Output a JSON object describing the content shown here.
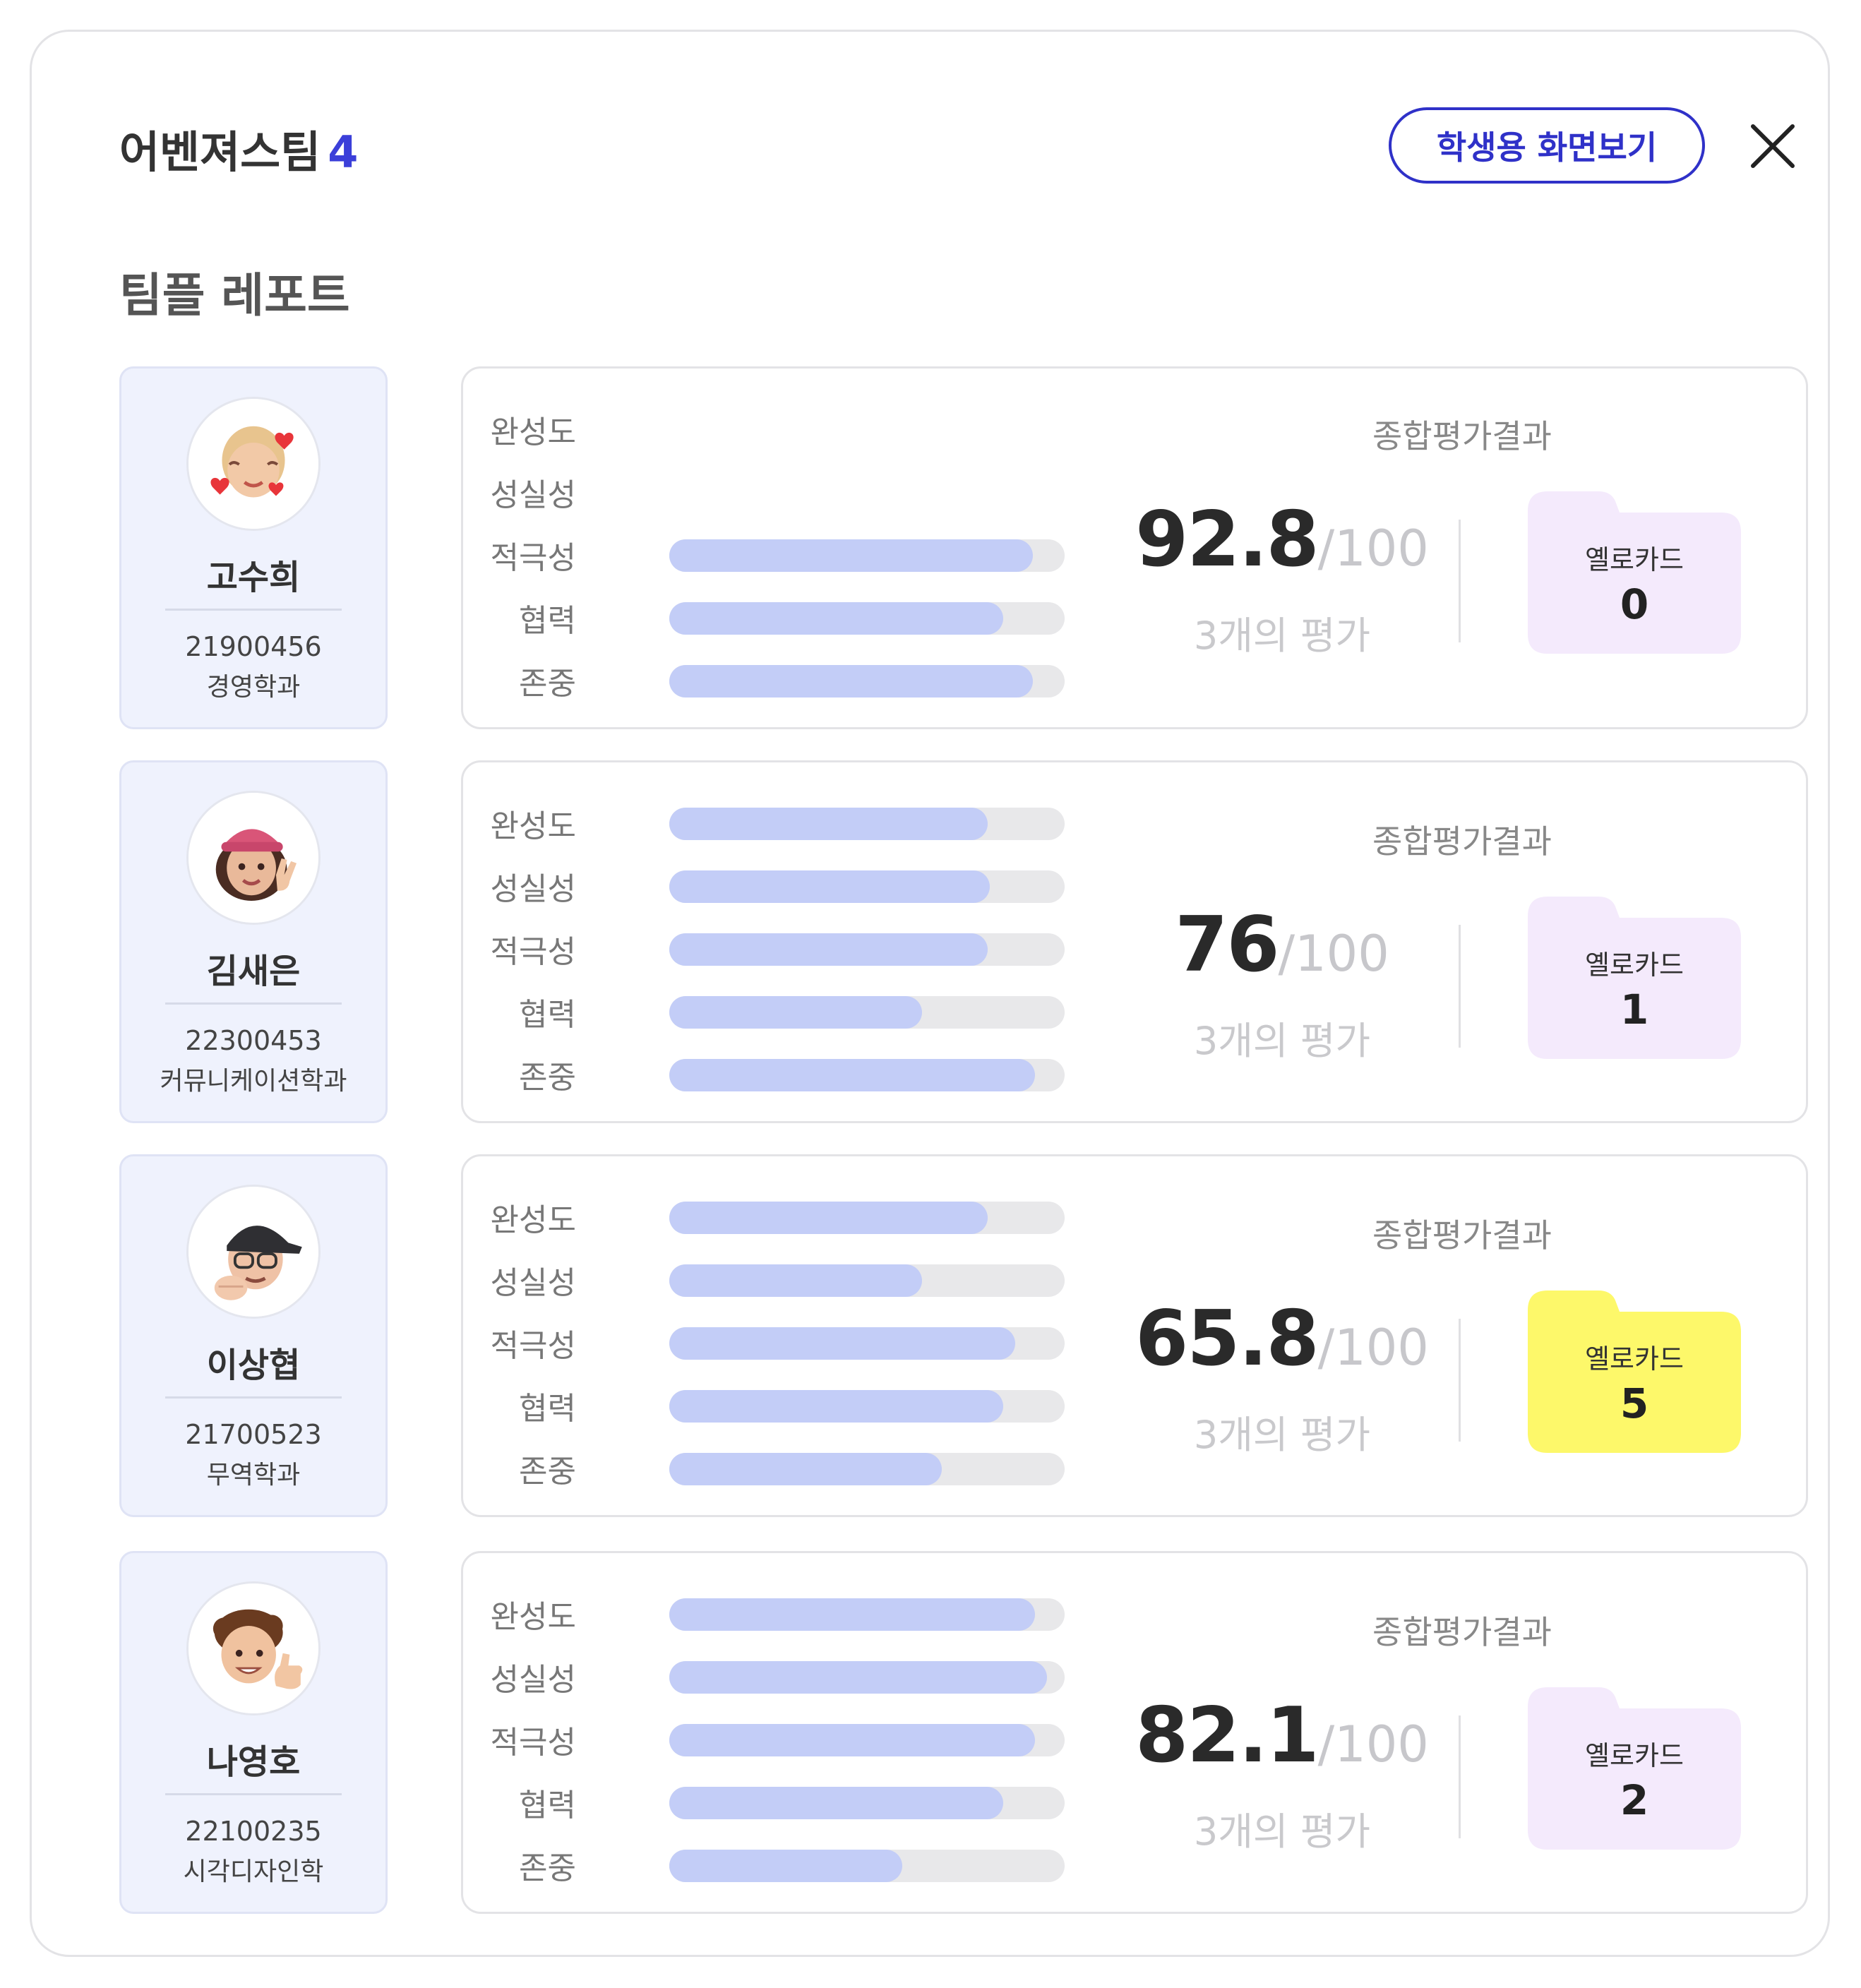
{
  "header": {
    "team_name": "어벤져스팀",
    "team_count": "4",
    "student_view_button": "학생용 화면보기",
    "close_icon": "close-icon"
  },
  "report_title": "팀플 레포트",
  "colors": {
    "accent": "#2f31c8",
    "bar_fill": "#c3cdf7",
    "bar_track": "#e8e8ea",
    "member_card_bg": "#eff2fd",
    "yellow_card_default": "#f4eafc",
    "yellow_card_active": "#fdf86a"
  },
  "members": [
    {
      "name": "고수희",
      "student_id": "21900456",
      "department": "경영학과",
      "avatar_icon": "memoji-hearts-avatar",
      "metrics": [
        {
          "label": "완성도",
          "value": null
        },
        {
          "label": "성실성",
          "value": null
        },
        {
          "label": "적극성",
          "value": 0.92
        },
        {
          "label": "협력",
          "value": 0.845
        },
        {
          "label": "존중",
          "value": 0.92
        }
      ],
      "summary_label": "종합평가결과",
      "score": "92.8",
      "score_max": "/100",
      "eval_count": "3개의 평가",
      "yellow_card_label": "옐로카드",
      "yellow_card_count": "0",
      "yellow_card_active": false
    },
    {
      "name": "김새은",
      "student_id": "22300453",
      "department": "커뮤니케이션학과",
      "avatar_icon": "memoji-peace-sign-avatar",
      "metrics": [
        {
          "label": "완성도",
          "value": 0.805
        },
        {
          "label": "성실성",
          "value": 0.81
        },
        {
          "label": "적극성",
          "value": 0.805
        },
        {
          "label": "협력",
          "value": 0.64
        },
        {
          "label": "존중",
          "value": 0.925
        }
      ],
      "summary_label": "종합평가결과",
      "score": "76",
      "score_max": "/100",
      "eval_count": "3개의 평가",
      "yellow_card_label": "옐로카드",
      "yellow_card_count": "1",
      "yellow_card_active": false
    },
    {
      "name": "이상협",
      "student_id": "21700523",
      "department": "무역학과",
      "avatar_icon": "memoji-cap-glasses-avatar",
      "metrics": [
        {
          "label": "완성도",
          "value": 0.805
        },
        {
          "label": "성실성",
          "value": 0.64
        },
        {
          "label": "적극성",
          "value": 0.875
        },
        {
          "label": "협력",
          "value": 0.845
        },
        {
          "label": "존중",
          "value": 0.69
        }
      ],
      "summary_label": "종합평가결과",
      "score": "65.8",
      "score_max": "/100",
      "eval_count": "3개의 평가",
      "yellow_card_label": "옐로카드",
      "yellow_card_count": "5",
      "yellow_card_active": true
    },
    {
      "name": "나영호",
      "student_id": "22100235",
      "department": "시각디자인학",
      "avatar_icon": "memoji-thumbs-up-avatar",
      "metrics": [
        {
          "label": "완성도",
          "value": 0.925
        },
        {
          "label": "성실성",
          "value": 0.955
        },
        {
          "label": "적극성",
          "value": 0.925
        },
        {
          "label": "협력",
          "value": 0.845
        },
        {
          "label": "존중",
          "value": 0.59
        }
      ],
      "summary_label": "종합평가결과",
      "score": "82.1",
      "score_max": "/100",
      "eval_count": "3개의 평가",
      "yellow_card_label": "옐로카드",
      "yellow_card_count": "2",
      "yellow_card_active": false
    }
  ]
}
